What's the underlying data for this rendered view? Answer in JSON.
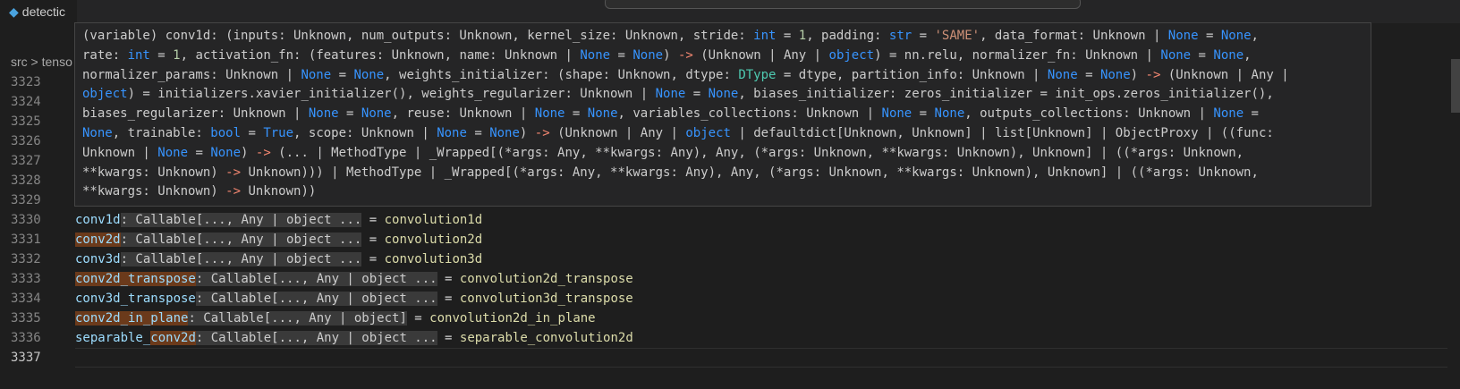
{
  "tab": {
    "label": "detectic",
    "icon": "python-file-icon"
  },
  "breadcrumb": "src > tenso",
  "line_numbers": [
    "3323",
    "3324",
    "3325",
    "3326",
    "3327",
    "3328",
    "3329",
    "3330",
    "3331",
    "3332",
    "3333",
    "3334",
    "3335",
    "3336",
    "3337"
  ],
  "code_lines": [
    {
      "name_pre": "",
      "name_hl": "",
      "name_post": "conv1d",
      "hint": ": Callable[..., Any | object ...",
      "eq": " = ",
      "value": "convolution1d"
    },
    {
      "name_pre": "",
      "name_hl": "conv2d",
      "name_post": "",
      "hint": ": Callable[..., Any | object ...",
      "eq": " = ",
      "value": "convolution2d"
    },
    {
      "name_pre": "",
      "name_hl": "",
      "name_post": "conv3d",
      "hint": ": Callable[..., Any | object ...",
      "eq": " = ",
      "value": "convolution3d"
    },
    {
      "name_pre": "",
      "name_hl": "conv2d_transpose",
      "name_post": "",
      "hint": ": Callable[..., Any | object ...",
      "eq": " = ",
      "value": "convolution2d_transpose"
    },
    {
      "name_pre": "",
      "name_hl": "",
      "name_post": "conv3d_transpose",
      "hint": ": Callable[..., Any | object ...",
      "eq": " = ",
      "value": "convolution3d_transpose"
    },
    {
      "name_pre": "",
      "name_hl": "conv2d_in_plane",
      "name_post": "",
      "hint": ": Callable[..., Any | object]",
      "eq": " = ",
      "value": "convolution2d_in_plane"
    },
    {
      "name_pre": "separable_",
      "name_hl": "conv2d",
      "name_post": "",
      "hint": ": Callable[..., Any | object ...",
      "eq": " = ",
      "value": "separable_convolution2d"
    }
  ],
  "hover_tokens": [
    [
      "t",
      "(variable) conv1d: (inputs: Unknown, num_outputs: Unknown, kernel_size: Unknown, stride: "
    ],
    [
      "k",
      "int"
    ],
    [
      "t",
      " = "
    ],
    [
      "n",
      "1"
    ],
    [
      "t",
      ", padding: "
    ],
    [
      "k",
      "str"
    ],
    [
      "t",
      " = "
    ],
    [
      "s",
      "'SAME'"
    ],
    [
      "t",
      ", data_format: Unknown | "
    ],
    [
      "k",
      "None"
    ],
    [
      "t",
      " = "
    ],
    [
      "k",
      "None"
    ],
    [
      "t",
      ",\nrate: "
    ],
    [
      "k",
      "int"
    ],
    [
      "t",
      " = "
    ],
    [
      "n",
      "1"
    ],
    [
      "t",
      ", activation_fn: (features: Unknown, name: Unknown | "
    ],
    [
      "k",
      "None"
    ],
    [
      "t",
      " = "
    ],
    [
      "k",
      "None"
    ],
    [
      "t",
      ") "
    ],
    [
      "a",
      "->"
    ],
    [
      "t",
      " (Unknown | Any | "
    ],
    [
      "k",
      "object"
    ],
    [
      "t",
      ") = nn.relu, normalizer_fn: Unknown | "
    ],
    [
      "k",
      "None"
    ],
    [
      "t",
      " = "
    ],
    [
      "k",
      "None"
    ],
    [
      "t",
      ",\nnormalizer_params: Unknown | "
    ],
    [
      "k",
      "None"
    ],
    [
      "t",
      " = "
    ],
    [
      "k",
      "None"
    ],
    [
      "t",
      ", weights_initializer: (shape: Unknown, dtype: "
    ],
    [
      "y",
      "DType"
    ],
    [
      "t",
      " = dtype, partition_info: Unknown | "
    ],
    [
      "k",
      "None"
    ],
    [
      "t",
      " = "
    ],
    [
      "k",
      "None"
    ],
    [
      "t",
      ") "
    ],
    [
      "a",
      "->"
    ],
    [
      "t",
      " (Unknown | Any |\n"
    ],
    [
      "k",
      "object"
    ],
    [
      "t",
      ") = initializers.xavier_initializer(), weights_regularizer: Unknown | "
    ],
    [
      "k",
      "None"
    ],
    [
      "t",
      " = "
    ],
    [
      "k",
      "None"
    ],
    [
      "t",
      ", biases_initializer: zeros_initializer = init_ops.zeros_initializer(),\nbiases_regularizer: Unknown | "
    ],
    [
      "k",
      "None"
    ],
    [
      "t",
      " = "
    ],
    [
      "k",
      "None"
    ],
    [
      "t",
      ", reuse: Unknown | "
    ],
    [
      "k",
      "None"
    ],
    [
      "t",
      " = "
    ],
    [
      "k",
      "None"
    ],
    [
      "t",
      ", variables_collections: Unknown | "
    ],
    [
      "k",
      "None"
    ],
    [
      "t",
      " = "
    ],
    [
      "k",
      "None"
    ],
    [
      "t",
      ", outputs_collections: Unknown | "
    ],
    [
      "k",
      "None"
    ],
    [
      "t",
      " =\n"
    ],
    [
      "k",
      "None"
    ],
    [
      "t",
      ", trainable: "
    ],
    [
      "k",
      "bool"
    ],
    [
      "t",
      " = "
    ],
    [
      "k",
      "True"
    ],
    [
      "t",
      ", scope: Unknown | "
    ],
    [
      "k",
      "None"
    ],
    [
      "t",
      " = "
    ],
    [
      "k",
      "None"
    ],
    [
      "t",
      ") "
    ],
    [
      "a",
      "->"
    ],
    [
      "t",
      " (Unknown | Any | "
    ],
    [
      "k",
      "object"
    ],
    [
      "t",
      " | defaultdict[Unknown, Unknown] | list[Unknown] | ObjectProxy | ((func:\nUnknown | "
    ],
    [
      "k",
      "None"
    ],
    [
      "t",
      " = "
    ],
    [
      "k",
      "None"
    ],
    [
      "t",
      ") "
    ],
    [
      "a",
      "->"
    ],
    [
      "t",
      " (... | MethodType | _Wrapped[(*args: Any, **kwargs: Any), Any, (*args: Unknown, **kwargs: Unknown), Unknown] | ((*args: Unknown,\n**kwargs: Unknown) "
    ],
    [
      "a",
      "->"
    ],
    [
      "t",
      " Unknown))) | MethodType | _Wrapped[(*args: Any, **kwargs: Any), Any, (*args: Unknown, **kwargs: Unknown), Unknown] | ((*args: Unknown,\n**kwargs: Unknown) "
    ],
    [
      "a",
      "->"
    ],
    [
      "t",
      " Unknown))"
    ]
  ],
  "colors": {
    "background": "#1e1e1e",
    "variable": "#9cdcfe",
    "function": "#dcdcaa",
    "keyword": "#3794ff",
    "string": "#ce9178",
    "number": "#b5cea8",
    "highlight": "#6b3a1b"
  }
}
